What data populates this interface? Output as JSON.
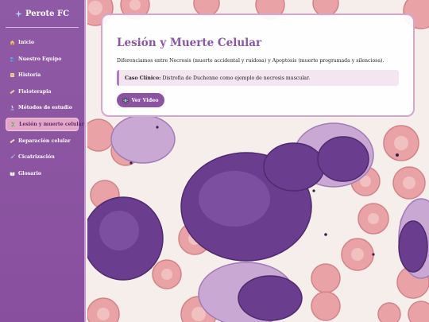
{
  "brand": {
    "icon": "sparkle-icon",
    "title": "Perote FC"
  },
  "nav": [
    {
      "label": "Inicio",
      "icon": "house-icon",
      "active": false
    },
    {
      "label": "Nuestro Equipo",
      "icon": "people-icon",
      "active": false
    },
    {
      "label": "Historia",
      "icon": "scroll-icon",
      "active": false
    },
    {
      "label": "Fisioterapia",
      "icon": "bandage-icon",
      "active": false
    },
    {
      "label": "Métodos de estudio",
      "icon": "microscope-icon",
      "active": false
    },
    {
      "label": "Lesión y muerte celular",
      "icon": "dna-icon",
      "active": true
    },
    {
      "label": "Reparación celular",
      "icon": "band-aid-icon",
      "active": false
    },
    {
      "label": "Cicatrización",
      "icon": "syringe-icon",
      "active": false
    },
    {
      "label": "Glosario",
      "icon": "book-icon",
      "active": false
    }
  ],
  "card": {
    "title": "Lesión y Muerte Celular",
    "description": "Diferenciamos entre Necrosis (muerte accidental y ruidosa) y Apoptosis (muerte programada y silenciosa).",
    "case_label": "Caso Clínico:",
    "case_text": "Distrofia de Duchenne como ejemplo de necrosis muscular.",
    "video_button": {
      "icon": "film-icon",
      "label": "Ver Video"
    }
  },
  "colors": {
    "sidebar": "#8f5aa5",
    "active_item": "#e2a6c8",
    "title": "#8a56a8",
    "button": "#8d53a3",
    "card_border": "#d6a6cf"
  }
}
